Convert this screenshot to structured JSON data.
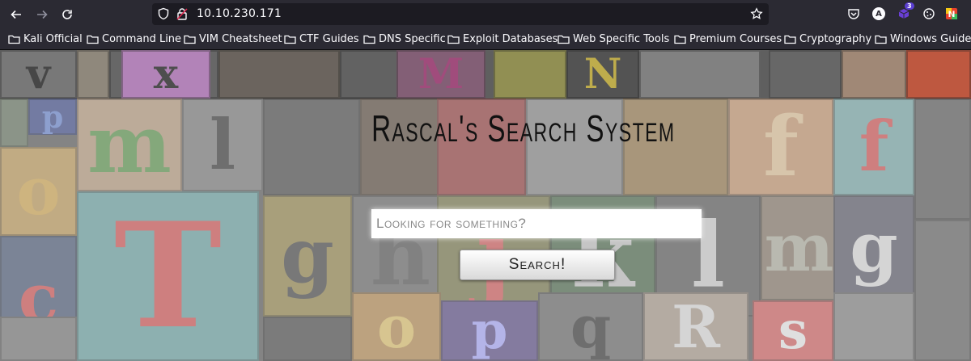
{
  "browser": {
    "url": "10.10.230.171",
    "extension_badge": "3",
    "profile_initial": "A"
  },
  "bookmarks": [
    {
      "label": "Kali Official"
    },
    {
      "label": "Command Line"
    },
    {
      "label": "VIM Cheatsheet"
    },
    {
      "label": "CTF Guides"
    },
    {
      "label": "DNS Specific"
    },
    {
      "label": "Exploit Databases"
    },
    {
      "label": "Web Specific Tools"
    },
    {
      "label": "Premium Courses"
    },
    {
      "label": "Cryptography"
    },
    {
      "label": "Windows Guide"
    }
  ],
  "page": {
    "title": "Rascal's Search System",
    "search_placeholder": "Looking for something?",
    "search_button": "Search!"
  },
  "colors": {
    "chrome_bg": "#2b2a33",
    "urlbar_bg": "#1c1b22",
    "text": "#fbfbfe"
  }
}
